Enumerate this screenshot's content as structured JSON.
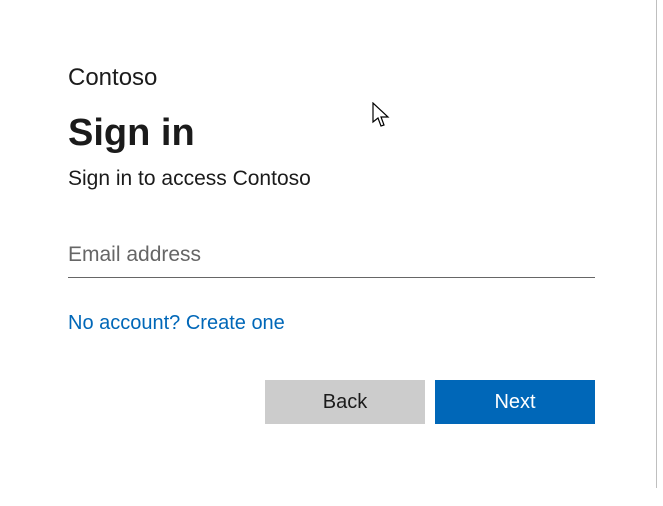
{
  "brand": "Contoso",
  "title": "Sign in",
  "subtitle": "Sign in to access Contoso",
  "email": {
    "placeholder": "Email address",
    "value": ""
  },
  "createLink": "No account? Create one",
  "buttons": {
    "back": "Back",
    "next": "Next"
  },
  "colors": {
    "primary": "#0067b8",
    "secondaryBg": "#cccccc",
    "text": "#1b1b1b"
  }
}
